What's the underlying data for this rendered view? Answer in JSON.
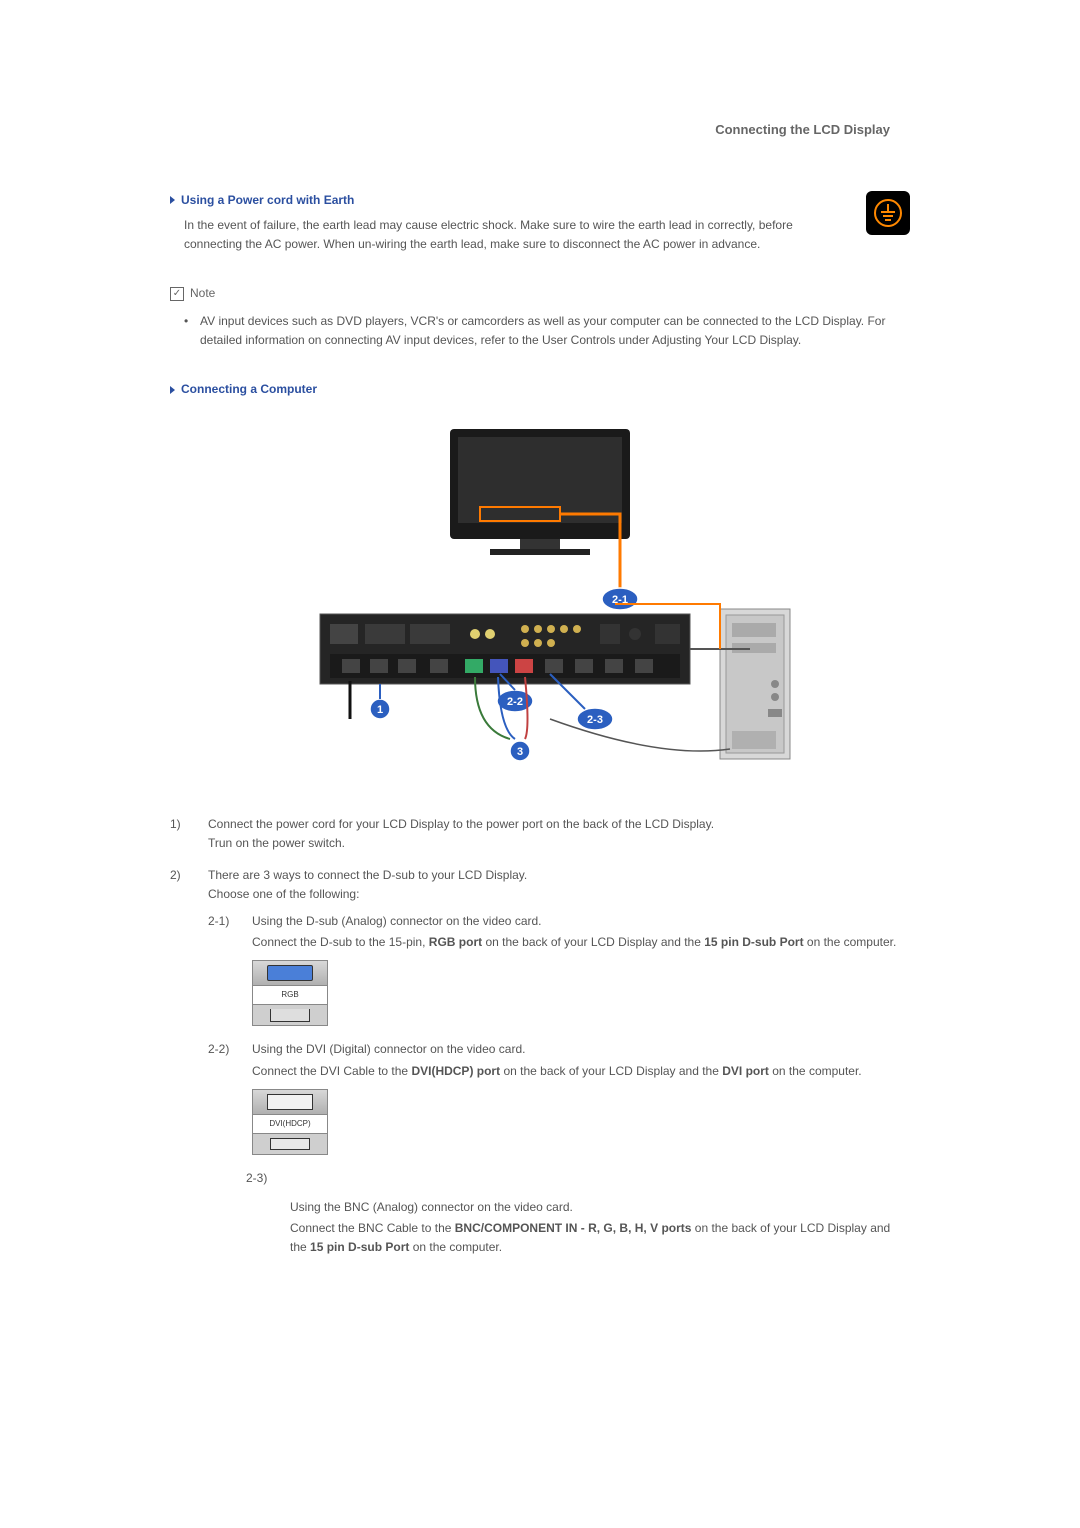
{
  "header": {
    "title": "Connecting the LCD Display"
  },
  "section1": {
    "heading": "Using a Power cord with Earth",
    "paragraph": "In the event of failure, the earth lead may cause electric shock. Make sure to wire the earth lead in correctly, before connecting the AC power. When un-wiring the earth lead, make sure to disconnect the AC power in advance."
  },
  "note": {
    "label": "Note",
    "item": "AV input devices such as DVD players, VCR's or camcorders as well as your computer can be connected to the LCD Display. For detailed information on connecting AV input devices, refer to the User Controls under Adjusting Your LCD Display."
  },
  "section2": {
    "heading": "Connecting a Computer"
  },
  "steps": {
    "s1": {
      "num": "1)",
      "line1": "Connect the power cord for your LCD Display to the power port on the back of the LCD Display.",
      "line2": "Trun on the power switch."
    },
    "s2": {
      "num": "2)",
      "line1": "There are 3 ways to connect the D-sub to your LCD Display.",
      "line2": "Choose one of the following:",
      "sub21": {
        "num": "2-1)",
        "line1": "Using the D-sub (Analog) connector on the video card.",
        "line2a": "Connect the D-sub to the 15-pin, ",
        "line2b": "RGB port",
        "line2c": " on the back of your LCD Display and the ",
        "line2d": "15 pin D-sub Port",
        "line2e": " on the computer.",
        "portlabel": "RGB"
      },
      "sub22": {
        "num": "2-2)",
        "line1": "Using the DVI (Digital) connector on the video card.",
        "line2a": "Connect the DVI Cable to the ",
        "line2b": "DVI(HDCP) port",
        "line2c": " on the back of your LCD Display and the ",
        "line2d": "DVI port",
        "line2e": " on the computer.",
        "portlabel": "DVI(HDCP)"
      },
      "sub23": {
        "num": "2-3)",
        "line1": "Using the BNC (Analog) connector on the video card.",
        "line2a": "Connect the BNC Cable to the ",
        "line2b": "BNC/COMPONENT IN - R, G, B, H, V ports",
        "line2c": " on the back of your LCD Display and the ",
        "line2d": "15 pin D-sub Port",
        "line2e": " on the computer."
      }
    }
  }
}
